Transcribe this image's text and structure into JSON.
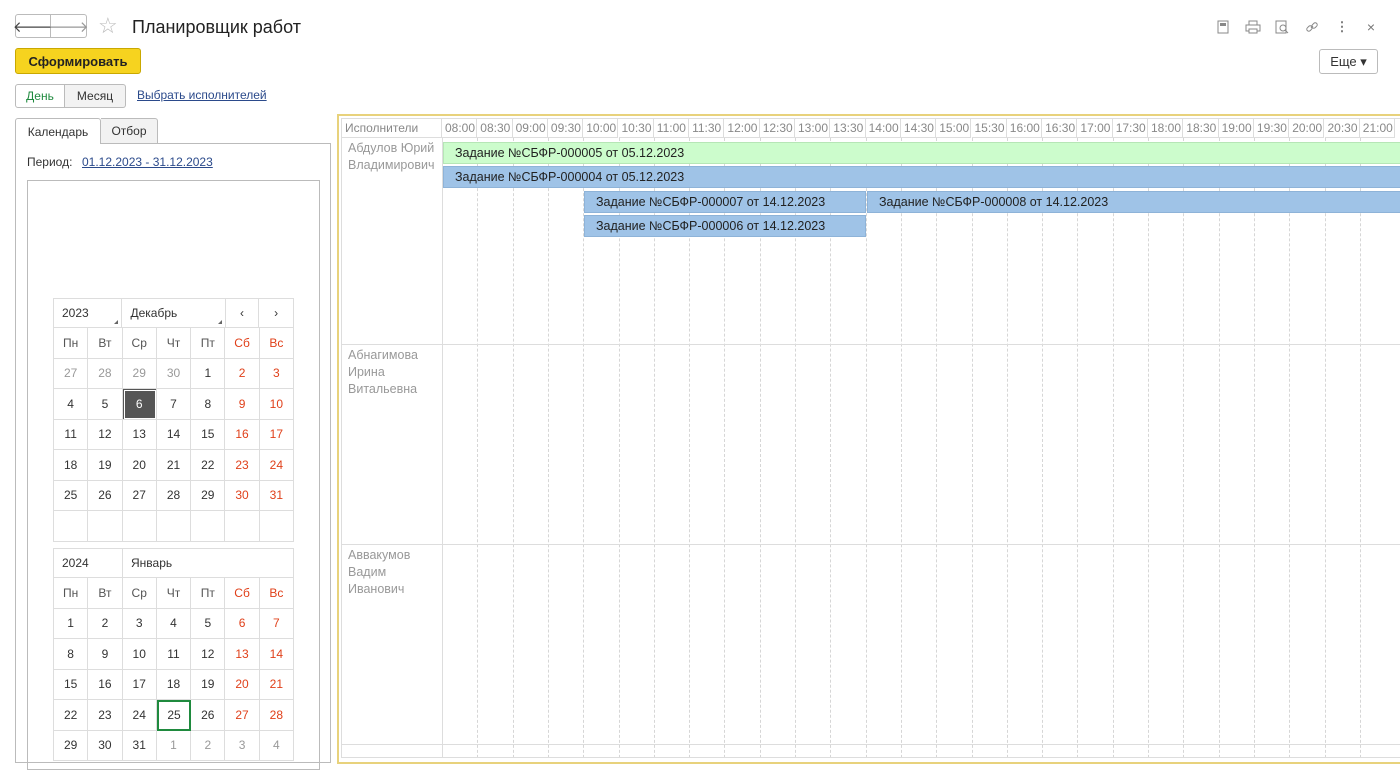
{
  "window": {
    "title": "Планировщик работ"
  },
  "toolbar": {
    "form_label": "Сформировать",
    "more_label": "Еще ▾"
  },
  "view": {
    "day_label": "День",
    "month_label": "Месяц",
    "select_exec_label": "Выбрать исполнителей"
  },
  "tabs": {
    "calendar": "Календарь",
    "filter": "Отбор"
  },
  "period": {
    "label": "Период:",
    "value": "01.12.2023 - 31.12.2023"
  },
  "calendar": {
    "weekdays": [
      "Пн",
      "Вт",
      "Ср",
      "Чт",
      "Пт",
      "Сб",
      "Вс"
    ],
    "months": [
      {
        "year": "2023",
        "month": "Декабрь",
        "prev": "‹",
        "next": "›",
        "days": [
          "27",
          "28",
          "29",
          "30",
          "1",
          "2",
          "3",
          "4",
          "5",
          "6",
          "7",
          "8",
          "9",
          "10",
          "11",
          "12",
          "13",
          "14",
          "15",
          "16",
          "17",
          "18",
          "19",
          "20",
          "21",
          "22",
          "23",
          "24",
          "25",
          "26",
          "27",
          "28",
          "29",
          "30",
          "31",
          "",
          "",
          "",
          "",
          "",
          "",
          ""
        ],
        "other_month_count_start": 4,
        "selected_index": 9
      },
      {
        "year": "2024",
        "month": "Январь",
        "days": [
          "1",
          "2",
          "3",
          "4",
          "5",
          "6",
          "7",
          "8",
          "9",
          "10",
          "11",
          "12",
          "13",
          "14",
          "15",
          "16",
          "17",
          "18",
          "19",
          "20",
          "21",
          "22",
          "23",
          "24",
          "25",
          "26",
          "27",
          "28",
          "29",
          "30",
          "31",
          "1",
          "2",
          "3",
          "4"
        ],
        "today_index": 24,
        "other_month_from_index": 31
      }
    ]
  },
  "schedule": {
    "resource_header": "Исполнители",
    "times": [
      "08:00",
      "08:30",
      "09:00",
      "09:30",
      "10:00",
      "10:30",
      "11:00",
      "11:30",
      "12:00",
      "12:30",
      "13:00",
      "13:30",
      "14:00",
      "14:30",
      "15:00",
      "15:30",
      "16:00",
      "16:30",
      "17:00",
      "17:30",
      "18:00",
      "18:30",
      "19:00",
      "19:30",
      "20:00",
      "20:30",
      "21:00"
    ],
    "resources": [
      "Абдулов Юрий Владимирович",
      "Абнагимова Ирина Витальевна",
      "Аввакумов Вадим Иванович"
    ],
    "tasks": [
      {
        "label": "Задание №СБФР-000005 от 05.12.2023",
        "color": "#ccfccc"
      },
      {
        "label": "Задание №СБФР-000004 от 05.12.2023",
        "color": "#9fc3e7"
      },
      {
        "label": "Задание №СБФР-000007 от 14.12.2023",
        "color": "#9fc3e7"
      },
      {
        "label": "Задание №СБФР-000008 от 14.12.2023",
        "color": "#9fc3e7"
      },
      {
        "label": "Задание №СБФР-000006 от 14.12.2023",
        "color": "#9fc3e7"
      }
    ]
  },
  "icons": [
    "back-arrow-icon",
    "forward-arrow-icon",
    "star-icon",
    "save-icon",
    "print-icon",
    "preview-icon",
    "link-icon",
    "more-vertical-icon",
    "close-icon"
  ]
}
